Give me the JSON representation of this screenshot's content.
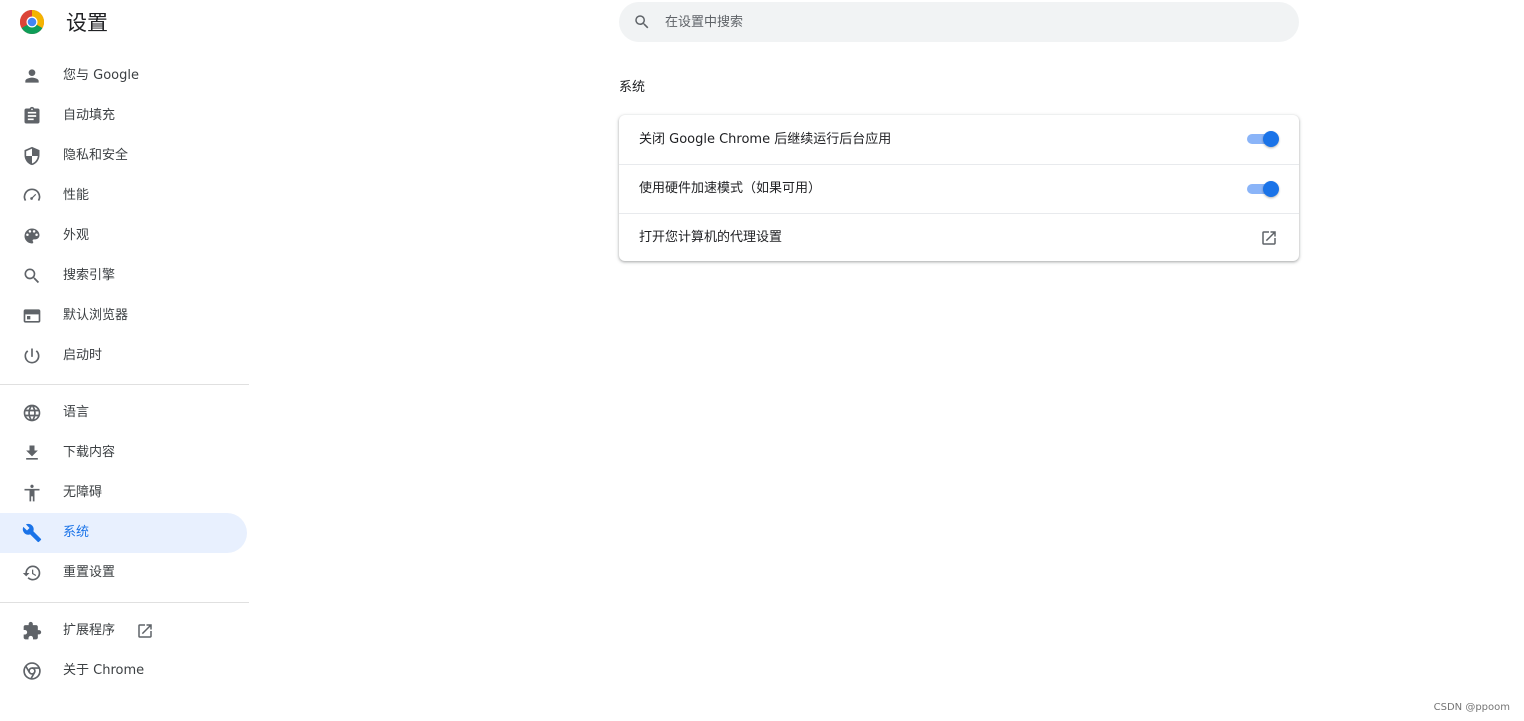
{
  "app": {
    "title": "设置"
  },
  "search": {
    "placeholder": "在设置中搜索",
    "value": ""
  },
  "sidebar": {
    "group1": [
      {
        "label": "您与 Google",
        "icon": "person-icon"
      },
      {
        "label": "自动填充",
        "icon": "clipboard-icon"
      },
      {
        "label": "隐私和安全",
        "icon": "shield-icon"
      },
      {
        "label": "性能",
        "icon": "speedometer-icon"
      },
      {
        "label": "外观",
        "icon": "palette-icon"
      },
      {
        "label": "搜索引擎",
        "icon": "search-icon"
      },
      {
        "label": "默认浏览器",
        "icon": "browser-window-icon"
      },
      {
        "label": "启动时",
        "icon": "power-icon"
      }
    ],
    "group2": [
      {
        "label": "语言",
        "icon": "globe-icon"
      },
      {
        "label": "下载内容",
        "icon": "download-icon"
      },
      {
        "label": "无障碍",
        "icon": "accessibility-icon"
      },
      {
        "label": "系统",
        "icon": "wrench-icon",
        "active": true
      },
      {
        "label": "重置设置",
        "icon": "history-icon"
      }
    ],
    "group3": [
      {
        "label": "扩展程序",
        "icon": "puzzle-icon"
      },
      {
        "label": "关于 Chrome",
        "icon": "chrome-icon"
      }
    ]
  },
  "main": {
    "section_title": "系统",
    "rows": [
      {
        "label": "关闭 Google Chrome 后继续运行后台应用",
        "control": "toggle",
        "on": true
      },
      {
        "label": "使用硬件加速模式（如果可用）",
        "control": "toggle",
        "on": true
      },
      {
        "label": "打开您计算机的代理设置",
        "control": "open-external"
      }
    ]
  },
  "colors": {
    "accent": "#1a73e8",
    "active_bg": "#e8f0fe",
    "toggle_track": "#8ab4f8"
  },
  "watermark": "CSDN @ppoom"
}
